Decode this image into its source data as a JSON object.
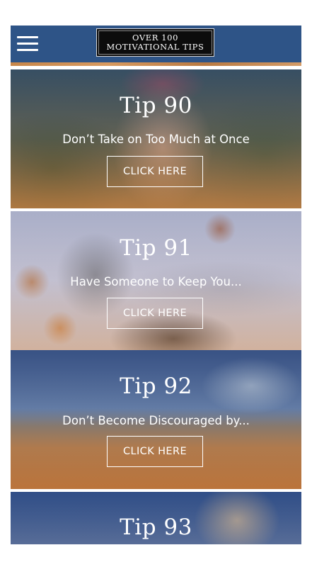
{
  "header": {
    "logo_line1": "OVER 100",
    "logo_line2": "MOTIVATIONAL TIPS",
    "bar_color": "#2e5487"
  },
  "tips": [
    {
      "title": "Tip 90",
      "description": "Don’t Take on Too Much at Once",
      "button": "CLICK HERE"
    },
    {
      "title": "Tip 91",
      "description": "Have Someone to Keep You...",
      "button": "CLICK HERE"
    },
    {
      "title": "Tip 92",
      "description": "Don’t Become Discouraged by...",
      "button": "CLICK HERE"
    },
    {
      "title": "Tip 93"
    }
  ]
}
